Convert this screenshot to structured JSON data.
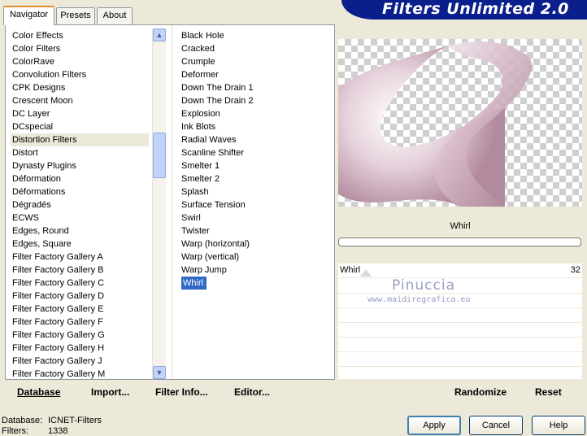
{
  "app_title": "Filters Unlimited 2.0",
  "tabs": [
    "Navigator",
    "Presets",
    "About"
  ],
  "categories": [
    "Color Effects",
    "Color Filters",
    "ColorRave",
    "Convolution Filters",
    "CPK Designs",
    "Crescent Moon",
    "DC Layer",
    "DCspecial",
    "Distortion Filters",
    "Distort",
    "Dynasty Plugins",
    "Déformation",
    "Déformations",
    "Dégradés",
    "ECWS",
    "Edges, Round",
    "Edges, Square",
    "Filter Factory Gallery A",
    "Filter Factory Gallery B",
    "Filter Factory Gallery C",
    "Filter Factory Gallery D",
    "Filter Factory Gallery E",
    "Filter Factory Gallery F",
    "Filter Factory Gallery G",
    "Filter Factory Gallery H",
    "Filter Factory Gallery J",
    "Filter Factory Gallery M"
  ],
  "selected_category": "Distortion Filters",
  "filters": [
    "Black Hole",
    "Cracked",
    "Crumple",
    "Deformer",
    "Down The Drain 1",
    "Down The Drain 2",
    "Explosion",
    "Ink Blots",
    "Radial Waves",
    "Scanline Shifter",
    "Smelter 1",
    "Smelter 2",
    "Splash",
    "Surface Tension",
    "Swirl",
    "Twister",
    "Warp (horizontal)",
    "Warp (vertical)",
    "Warp Jump",
    "Whirl"
  ],
  "selected_filter": "Whirl",
  "preview": {
    "filter_name": "Whirl",
    "watermark_name": "Pinuccia",
    "watermark_url": "www.maidiregrafica.eu"
  },
  "slider": {
    "label": "Whirl",
    "value": "32",
    "max_value": 255
  },
  "commands": {
    "database": "Database",
    "import": "Import...",
    "filter_info": "Filter Info...",
    "editor": "Editor...",
    "randomize": "Randomize",
    "reset": "Reset"
  },
  "status": {
    "database_label": "Database:",
    "database_value": "ICNET-Filters",
    "filters_label": "Filters:",
    "filters_value": "1338"
  },
  "buttons": {
    "apply": "Apply",
    "cancel": "Cancel",
    "help": "Help"
  }
}
